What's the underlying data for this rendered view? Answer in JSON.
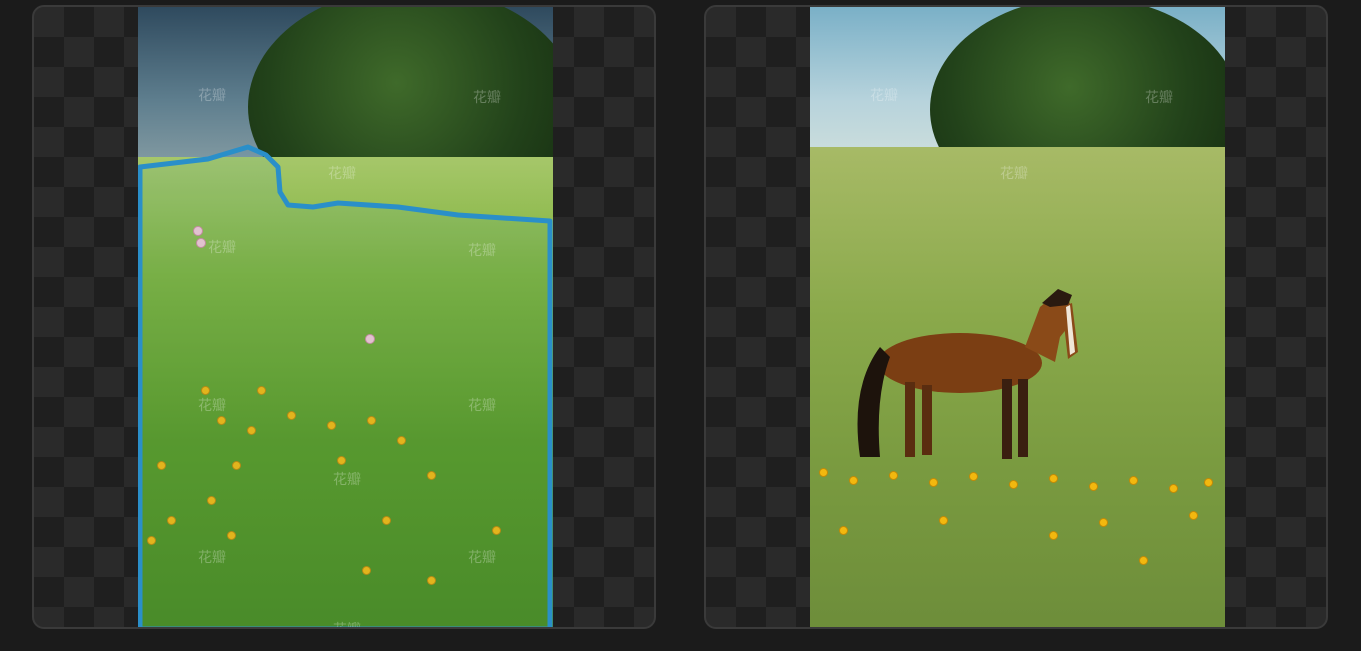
{
  "panels": [
    {
      "id": "left",
      "label": "",
      "watermark": "花瓣"
    },
    {
      "id": "right",
      "label": "",
      "watermark": "花瓣"
    }
  ],
  "colors": {
    "background": "#1b1b1b",
    "mask_outline": "#2a8fc9",
    "flower": "#f2b80f",
    "point_marker": "#f1c7d0"
  },
  "icons": [
    "watermark-logo-icon",
    "point-marker-icon"
  ]
}
